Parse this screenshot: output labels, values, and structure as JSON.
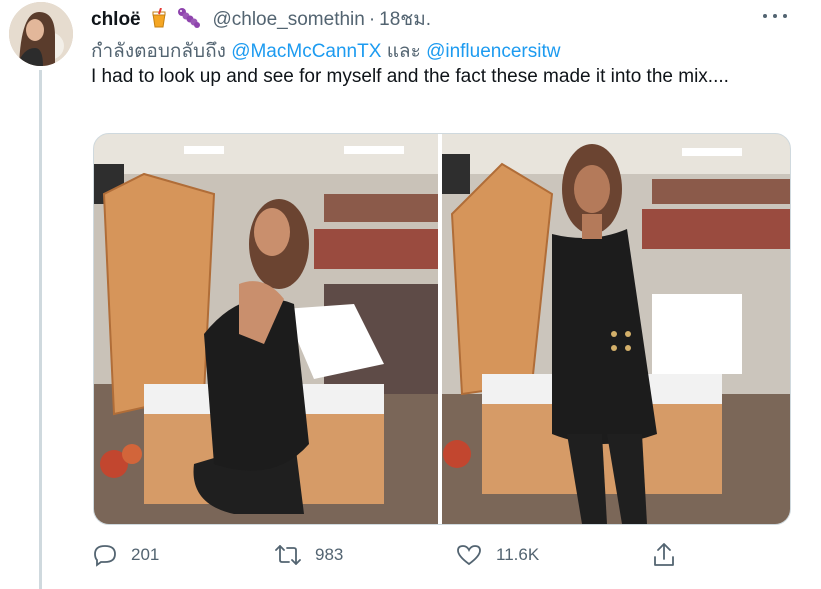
{
  "colors": {
    "text": "#0f1419",
    "secondary": "#536471",
    "accent": "#1d9bf0",
    "border": "#cfd9de"
  },
  "tweet": {
    "display_name": "chloë",
    "emojis": [
      "beverage-icon",
      "caterpillar-icon"
    ],
    "handle": "@chloe_somethin",
    "separator": "·",
    "time": "18ชม.",
    "reply_prefix": "กำลังตอบกลับถึง",
    "reply_to_1": "@MacMcCannTX",
    "reply_joiner": "และ",
    "reply_to_2": "@influencersitw",
    "text": "I had to look up and see for myself and the fact these made it into the mix....",
    "actions": {
      "reply_count": "201",
      "retweet_count": "983",
      "like_count": "11.6K"
    }
  }
}
